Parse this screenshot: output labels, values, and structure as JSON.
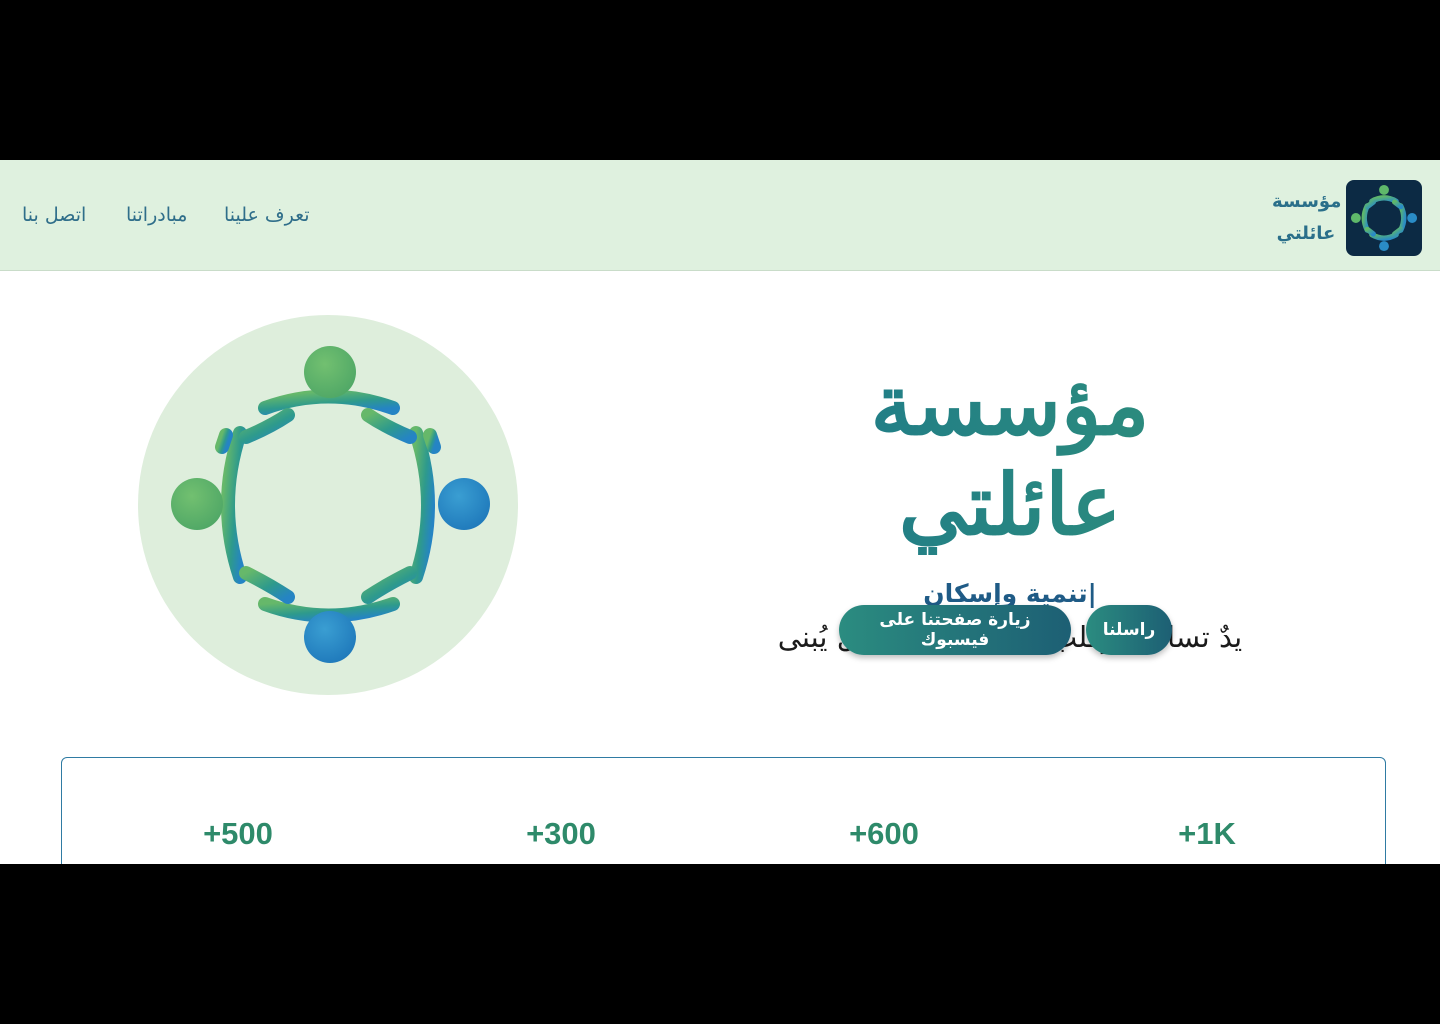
{
  "navbar": {
    "links": [
      {
        "label": "اتصل بنا"
      },
      {
        "label": "مبادراتنا"
      },
      {
        "label": "تعرف علينا"
      }
    ],
    "brand": {
      "line1": "مؤسسة",
      "line2": "عائلتي"
    }
  },
  "hero": {
    "title": "مؤسسة عائلتي",
    "subtitle": "تنمية وإسكان|",
    "tagline": "يدٌ تساعد، وقلبٌ يعطف، ومستقبلٌ يُبنى",
    "buttons": {
      "contact": "راسلنا",
      "facebook": "زيارة صفحتنا على فيسبوك"
    }
  },
  "stats": [
    "+500",
    "+300",
    "+600",
    "+1K"
  ],
  "colors": {
    "navbar_bg": "#dff1df",
    "accent": "#2e8a6a",
    "link": "#2f6e8a",
    "button_gradient_start": "#2b8c80",
    "button_gradient_end": "#1d5f74"
  },
  "icons": {
    "brand_logo": "family-circle-logo",
    "hero_image": "family-circle-logo"
  }
}
